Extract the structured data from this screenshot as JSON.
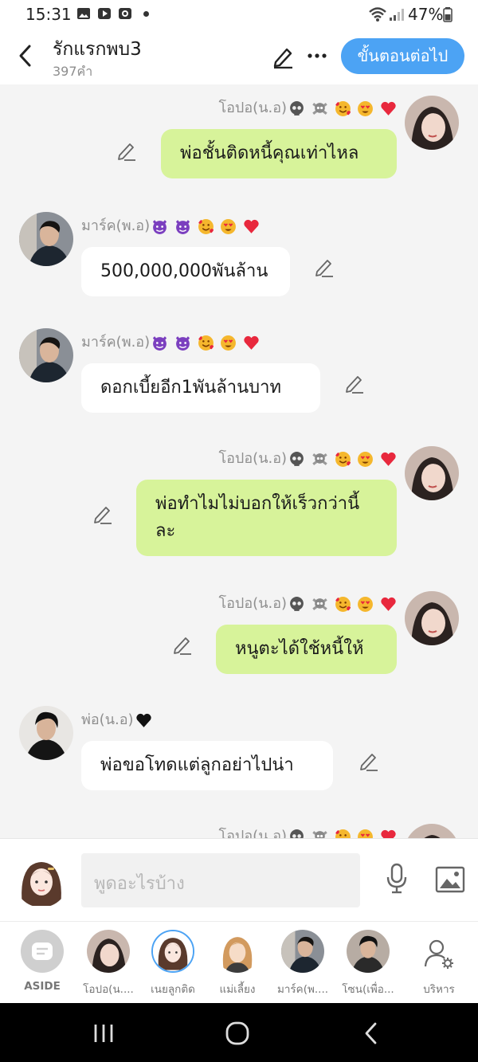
{
  "status_bar": {
    "time": "15:31",
    "battery": "47%"
  },
  "header": {
    "title": "รักแรกพบ3",
    "subtitle": "397คำ",
    "next_label": "ขั้นตอนต่อไป"
  },
  "messages": [
    {
      "side": "me",
      "sender": "โอปอ(น.อ)",
      "sender_emojis": [
        "skull",
        "skull-crossbones",
        "smiling-hearts",
        "heart-eyes",
        "red-heart"
      ],
      "text": "พ่อชั้นติดหนี้คุณเท่าไหล"
    },
    {
      "side": "them",
      "sender": "มาร์ค(พ.อ)",
      "sender_emojis": [
        "purple-devil",
        "purple-devil",
        "smiling-hearts",
        "heart-eyes",
        "red-heart"
      ],
      "text": "500,000,000พันล้าน"
    },
    {
      "side": "them",
      "sender": "มาร์ค(พ.อ)",
      "sender_emojis": [
        "purple-devil",
        "purple-devil",
        "smiling-hearts",
        "heart-eyes",
        "red-heart"
      ],
      "text": "ดอกเบี้ยอีก1พันล้านบาท"
    },
    {
      "side": "me",
      "sender": "โอปอ(น.อ)",
      "sender_emojis": [
        "skull",
        "skull-crossbones",
        "smiling-hearts",
        "heart-eyes",
        "red-heart"
      ],
      "text": "พ่อทำไมไม่บอกให้เร็วกว่านี้ละ"
    },
    {
      "side": "me",
      "sender": "โอปอ(น.อ)",
      "sender_emojis": [
        "skull",
        "skull-crossbones",
        "smiling-hearts",
        "heart-eyes",
        "red-heart"
      ],
      "text": "หนูตะได้ใช้หนี้ให้"
    },
    {
      "side": "them",
      "sender": "พ่อ(น.อ)",
      "sender_emojis": [
        "black-heart"
      ],
      "text": "พ่อขอโทดแต่ลูกอย่าไปน่า"
    },
    {
      "side": "me",
      "sender": "โอปอ(น.อ)",
      "sender_emojis": [
        "skull",
        "skull-crossbones",
        "smiling-hearts",
        "heart-eyes",
        "red-heart"
      ],
      "text": ""
    }
  ],
  "composer": {
    "placeholder": "พูดอะไรบ้าง"
  },
  "characters": [
    {
      "name": "ASIDE"
    },
    {
      "name": "โอปอ(น...."
    },
    {
      "name": "เนยลูกติด"
    },
    {
      "name": "แม่เลี้ยง"
    },
    {
      "name": "มาร์ค(พ...."
    },
    {
      "name": "โซน(เพื่อ..."
    },
    {
      "name": "บริหาร"
    }
  ],
  "colors": {
    "accent": "#4ca3f4",
    "my_bubble": "#d7f39a",
    "their_bubble": "#ffffff",
    "background": "#f4f4f4"
  },
  "icons": [
    "back-icon",
    "edit-icon",
    "more-icon",
    "pencil-icon",
    "mic-icon",
    "image-icon",
    "manage-icon",
    "recent-apps-icon",
    "home-icon",
    "nav-back-icon"
  ]
}
